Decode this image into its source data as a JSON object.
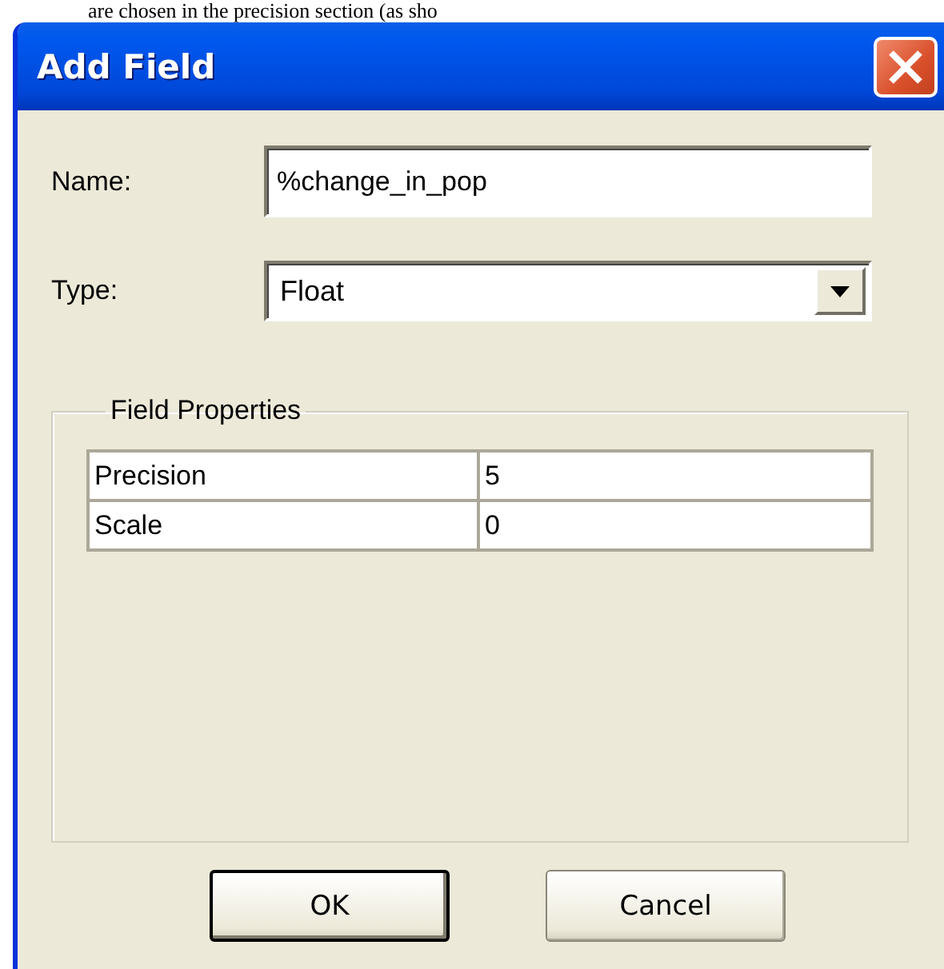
{
  "page_text": "are chosen in the precision section (as sho",
  "window": {
    "title": "Add Field"
  },
  "name_field": {
    "label": "Name:",
    "value": "%change_in_pop"
  },
  "type_field": {
    "label": "Type:",
    "value": "Float"
  },
  "field_properties": {
    "title": "Field Properties",
    "rows": [
      {
        "property": "Precision",
        "value": "5"
      },
      {
        "property": "Scale",
        "value": "0"
      }
    ]
  },
  "buttons": [
    {
      "label": "OK",
      "default": true
    },
    {
      "label": "Cancel",
      "default": false
    }
  ]
}
